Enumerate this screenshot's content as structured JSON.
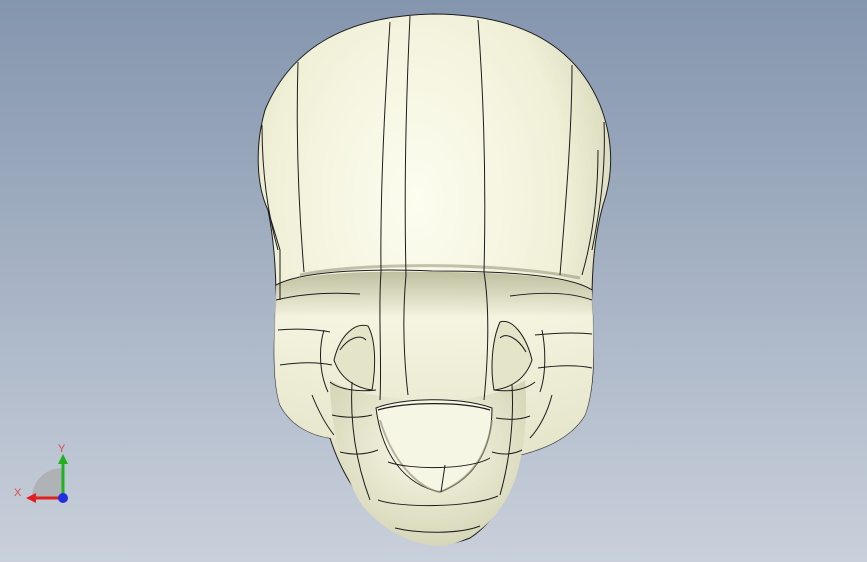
{
  "viewport": {
    "background_top": "#8495ae",
    "background_bottom": "#c9d0db",
    "model_fill": "#f2f2dc",
    "edge_color": "#1c1c1c"
  },
  "triad": {
    "x_label": "X",
    "y_label": "Y",
    "x_color": "#e02020",
    "y_color": "#20b020",
    "z_color": "#2030e0"
  }
}
